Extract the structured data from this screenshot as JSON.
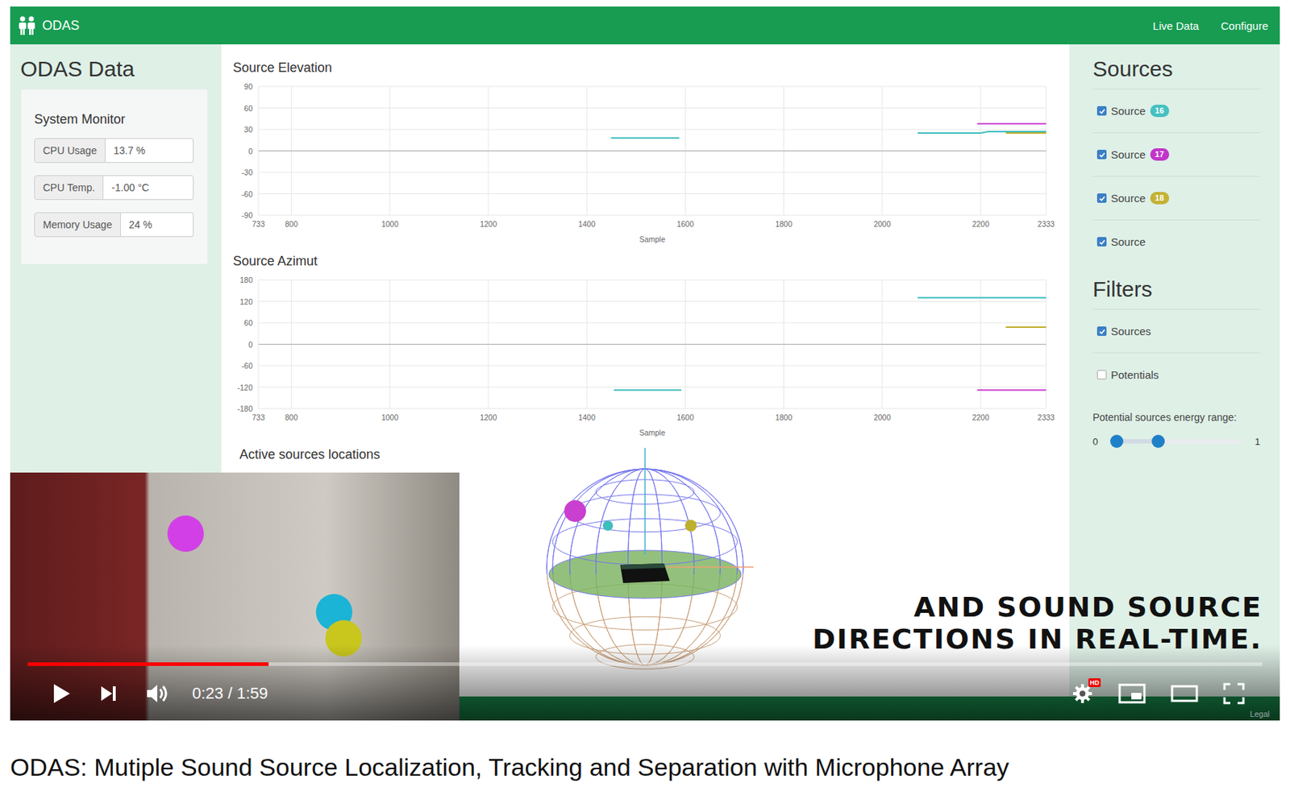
{
  "player": {
    "title": "ODAS: Mutiple Sound Source Localization, Tracking and Separation with Microphone Array",
    "time": "0:23 / 1:59",
    "level": 0.195,
    "paused": true,
    "quality_badge": "HD",
    "legal": "Legal"
  },
  "caption": {
    "lines": [
      "AND SOUND SOURCE",
      "DIRECTIONS IN REAL-TIME."
    ]
  },
  "camera": {
    "markers": [
      {
        "color": "#d23fe6"
      },
      {
        "color": "#1bb3d6"
      },
      {
        "color": "#c9c61e"
      }
    ]
  },
  "app": {
    "brand": "ODAS",
    "nav": [
      {
        "label": "Live Data"
      },
      {
        "label": "Configure"
      }
    ]
  },
  "left_panel": {
    "title": "ODAS Data",
    "monitor": {
      "title": "System Monitor",
      "rows": [
        {
          "label": "CPU Usage",
          "value": "13.7 %"
        },
        {
          "label": "CPU Temp.",
          "value": "-1.00 °C"
        },
        {
          "label": "Memory Usage",
          "value": "24 %"
        }
      ]
    }
  },
  "charts": [
    {
      "title": "Source Elevation",
      "y_ticks": [
        "90",
        "60",
        "30",
        "0",
        "-30",
        "-60",
        "-90"
      ],
      "x_ticks": [
        "733",
        "800",
        "1000",
        "1200",
        "1400",
        "1600",
        "1800",
        "2000",
        "2200",
        "2333"
      ],
      "x_label": "Sample",
      "series": [
        {
          "color": "#3dbdbd",
          "segments": [
            [
              [
                1449,
                18
              ],
              [
                1588,
                18
              ]
            ],
            [
              [
                2072,
                25
              ],
              [
                2200,
                25
              ],
              [
                2215,
                27
              ],
              [
                2333,
                27
              ]
            ]
          ]
        },
        {
          "color": "#c93fcf",
          "segments": [
            [
              [
                2193,
                38
              ],
              [
                2333,
                38
              ]
            ]
          ]
        },
        {
          "color": "#bdb02c",
          "segments": [
            [
              [
                2251,
                25
              ],
              [
                2333,
                25
              ]
            ]
          ]
        }
      ]
    },
    {
      "title": "Source Azimut",
      "y_ticks": [
        "180",
        "120",
        "60",
        "0",
        "-60",
        "-120",
        "-180"
      ],
      "x_ticks": [
        "733",
        "800",
        "1000",
        "1200",
        "1400",
        "1600",
        "1800",
        "2000",
        "2200",
        "2333"
      ],
      "x_label": "Sample",
      "series": [
        {
          "color": "#3dbdbd",
          "segments": [
            [
              [
                1455,
                -128
              ],
              [
                1592,
                -128
              ]
            ],
            [
              [
                2072,
                130
              ],
              [
                2333,
                130
              ]
            ]
          ]
        },
        {
          "color": "#c93fcf",
          "segments": [
            [
              [
                2193,
                -128
              ],
              [
                2333,
                -128
              ]
            ]
          ]
        },
        {
          "color": "#bdb02c",
          "segments": [
            [
              [
                2251,
                48
              ],
              [
                2333,
                48
              ]
            ]
          ]
        }
      ]
    }
  ],
  "locations": {
    "title": "Active sources locations",
    "points": [
      {
        "color": "#c93fcf"
      },
      {
        "color": "#3dbdbd"
      },
      {
        "color": "#bdb02c"
      }
    ]
  },
  "sources": {
    "title": "Sources",
    "items": [
      {
        "label": "Source",
        "badge": "16",
        "color": "#45c1c1",
        "checked": true
      },
      {
        "label": "Source",
        "badge": "17",
        "color": "#c135c9",
        "checked": true
      },
      {
        "label": "Source",
        "badge": "18",
        "color": "#c4b234",
        "checked": true
      },
      {
        "label": "Source",
        "checked": true
      }
    ]
  },
  "filters": {
    "title": "Filters",
    "items": [
      {
        "label": "Sources",
        "checked": true
      },
      {
        "label": "Potentials",
        "checked": false
      }
    ]
  },
  "energy_range": {
    "label": "Potential sources energy range:",
    "min_label": "0",
    "max_label": "1",
    "levels": [
      0,
      0.35
    ]
  }
}
